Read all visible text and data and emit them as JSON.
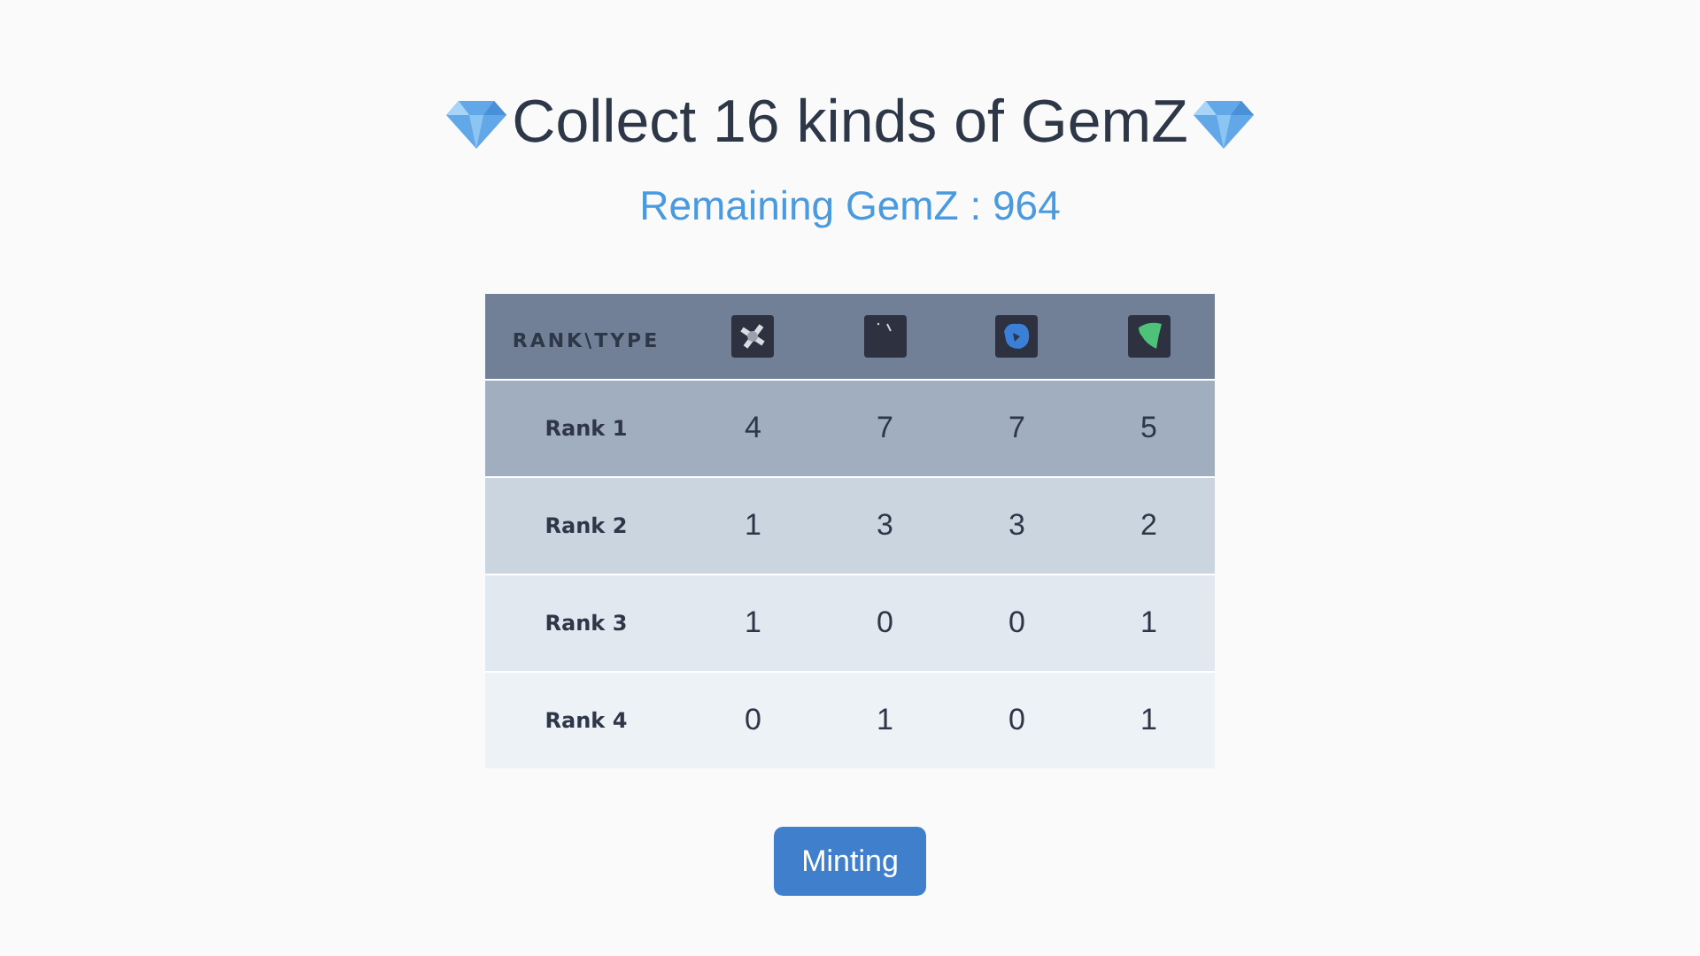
{
  "title": "Collect 16 kinds of GemZ",
  "subtitle": "Remaining GemZ : 964",
  "table": {
    "corner": "RANK\\TYPE",
    "columns": [
      {
        "kind": "cross"
      },
      {
        "kind": "dark"
      },
      {
        "kind": "blue"
      },
      {
        "kind": "green"
      }
    ],
    "rows": [
      {
        "label": "Rank 1",
        "color": "#a0aec0",
        "cells": [
          "4",
          "7",
          "7",
          "5"
        ]
      },
      {
        "label": "Rank 2",
        "color": "#cbd5e0",
        "cells": [
          "1",
          "3",
          "3",
          "2"
        ]
      },
      {
        "label": "Rank 3",
        "color": "#e2e8f0",
        "cells": [
          "1",
          "0",
          "0",
          "1"
        ]
      },
      {
        "label": "Rank 4",
        "color": "#edf2f7",
        "cells": [
          "0",
          "1",
          "0",
          "1"
        ]
      }
    ]
  },
  "button": "Minting"
}
